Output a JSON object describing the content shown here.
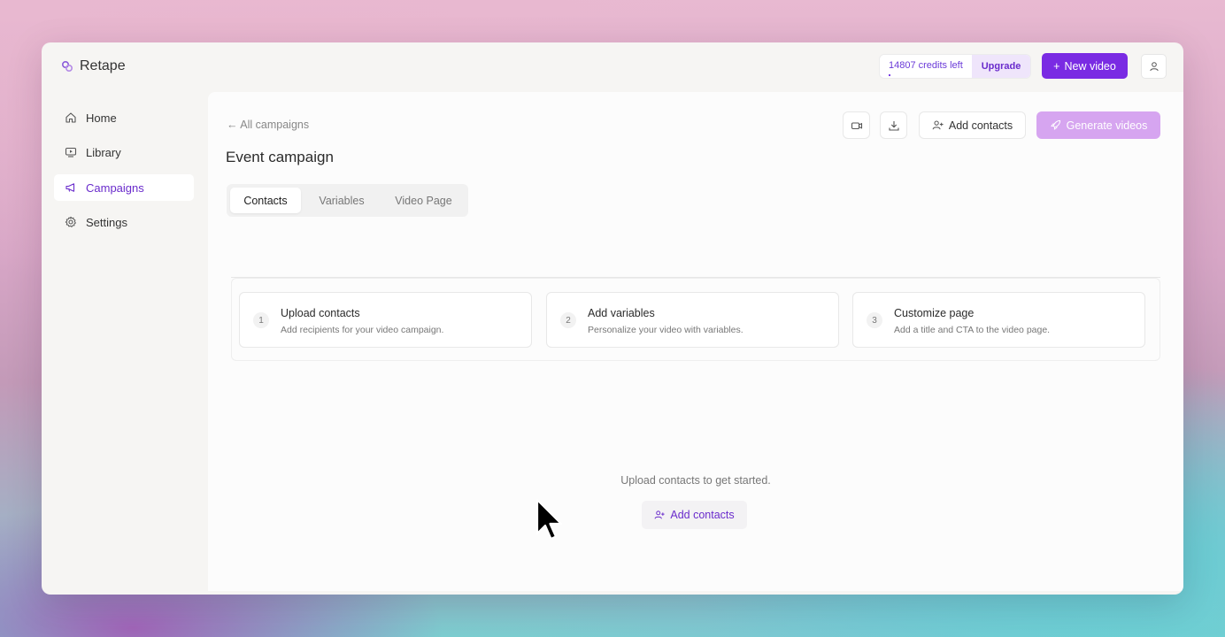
{
  "app": {
    "name": "Retape"
  },
  "header": {
    "credits_label": "14807 credits left",
    "upgrade_label": "Upgrade",
    "new_video_label": "New video",
    "new_video_prefix": "+"
  },
  "sidebar": {
    "items": [
      {
        "label": "Home",
        "icon": "home-icon",
        "active": false
      },
      {
        "label": "Library",
        "icon": "library-icon",
        "active": false
      },
      {
        "label": "Campaigns",
        "icon": "megaphone-icon",
        "active": true
      },
      {
        "label": "Settings",
        "icon": "gear-icon",
        "active": false
      }
    ],
    "collapse_glyph": "«"
  },
  "main": {
    "back_link": "← All campaigns",
    "title": "Event campaign",
    "add_contacts_label": "Add contacts",
    "generate_label": "Generate videos",
    "tabs": [
      {
        "label": "Contacts",
        "active": true
      },
      {
        "label": "Variables",
        "active": false
      },
      {
        "label": "Video Page",
        "active": false
      }
    ],
    "steps": [
      {
        "num": "1",
        "title": "Upload contacts",
        "desc": "Add recipients for your video campaign."
      },
      {
        "num": "2",
        "title": "Add variables",
        "desc": "Personalize your video with variables."
      },
      {
        "num": "3",
        "title": "Customize page",
        "desc": "Add a title and CTA to the video page."
      }
    ],
    "empty_text": "Upload contacts to get started.",
    "empty_button_label": "Add contacts"
  },
  "colors": {
    "accent": "#7a2be3",
    "accent_light": "#d6a5f0",
    "active_text": "#6a2ccc"
  }
}
